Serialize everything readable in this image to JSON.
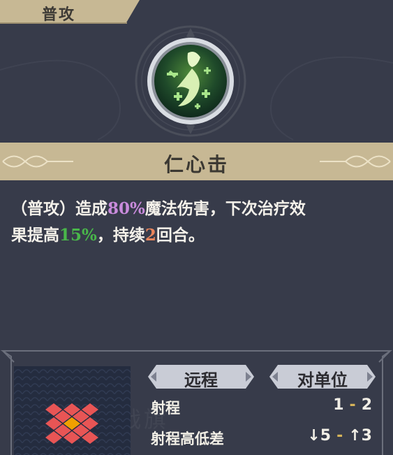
{
  "skill": {
    "type_tag": "普攻",
    "name": "仁心击",
    "icon": "healing-strike-icon"
  },
  "description": {
    "p1": "（普攻）造成",
    "v1": "80%",
    "p2": "魔法伤害，下次治疗效",
    "p3": "果提高",
    "v2": "15%",
    "p4": "，持续",
    "v3": "2",
    "p5": "回合。"
  },
  "attributes": {
    "attack_type": "远程",
    "target_type": "对单位",
    "range_label": "射程",
    "range_min": "1",
    "range_sep": "-",
    "range_max": "2",
    "height_label": "射程高低差",
    "height_down": "↓5",
    "height_sep": "-",
    "height_up": "↑3"
  },
  "watermark": "战旗",
  "colors": {
    "background": "#373b4a",
    "banner": "#c7b894",
    "damage": "#c98bdc",
    "heal": "#49b64a",
    "turns": "#e9855c",
    "range_tile": "#e85555",
    "center_tile": "#f0a000"
  }
}
